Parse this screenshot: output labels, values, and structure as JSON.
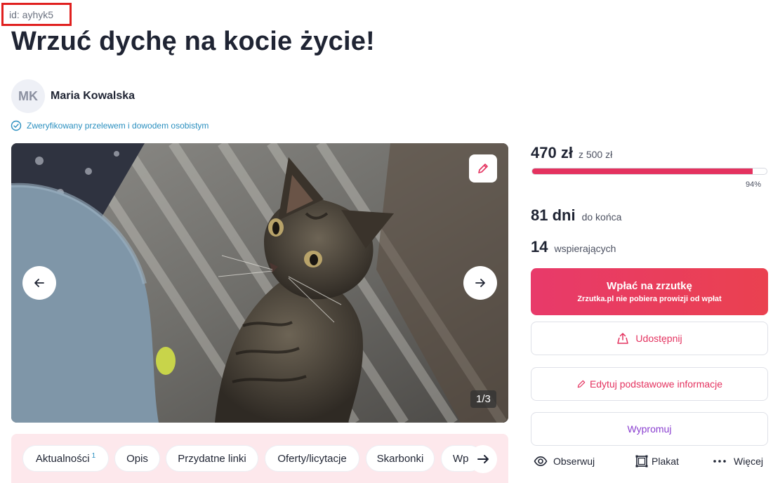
{
  "id_label": "id: ayhyk5",
  "title": "Wrzuć dychę na kocie życie!",
  "author": {
    "initials": "MK",
    "name": "Maria Kowalska"
  },
  "verified_text": "Zweryfikowany przelewem i dowodem osobistym",
  "gallery": {
    "counter": "1/3"
  },
  "tabs": [
    {
      "label": "Aktualności",
      "badge": "1"
    },
    {
      "label": "Opis"
    },
    {
      "label": "Przydatne linki"
    },
    {
      "label": "Oferty/licytacje"
    },
    {
      "label": "Skarbonki"
    },
    {
      "label": "Wp"
    }
  ],
  "funding": {
    "raised": "470 zł",
    "goal": "z 500 zł",
    "progress_fraction": 0.94,
    "percent": "94%"
  },
  "stats": {
    "days": "81 dni",
    "days_label": "do końca",
    "supporters": "14",
    "supporters_label": "wspierających"
  },
  "buttons": {
    "donate": "Wpłać na zrzutkę",
    "donate_note": "Zrzutka.pl nie pobiera prowizji od wpłat",
    "share": "Udostępnij",
    "edit": "Edytuj podstawowe informacje",
    "promote": "Wypromuj"
  },
  "actions": {
    "follow": "Obserwuj",
    "poster": "Plakat",
    "more": "Więcej"
  },
  "colors": {
    "accent": "#e4325f",
    "promote": "#8a3fd0",
    "verified": "#2a8fbf",
    "tabs_bg": "#fde8ec"
  },
  "icons": [
    "check-circle-icon",
    "pencil-icon",
    "arrow-left-icon",
    "arrow-right-icon",
    "share-icon",
    "eye-icon",
    "poster-icon",
    "more-dots-icon"
  ]
}
